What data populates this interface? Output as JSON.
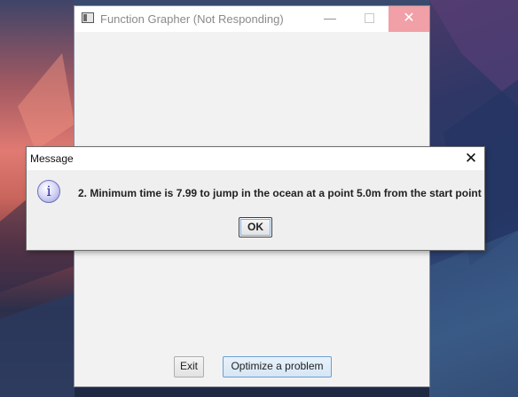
{
  "main_window": {
    "title": "Function Grapher (Not Responding)",
    "controls": {
      "minimize": "—",
      "close": "✕"
    },
    "buttons": {
      "exit": "Exit",
      "optimize": "Optimize a problem"
    }
  },
  "dialog": {
    "title": "Message",
    "icon": "info-icon",
    "icon_glyph": "i",
    "close": "✕",
    "message": "2. Minimum time is 7.99 to jump in the ocean at a point 5.0m from the start point",
    "ok_label": "OK"
  },
  "colors": {
    "close_hover": "#f0a0a6",
    "dialog_bg": "#efefef",
    "window_bg": "#f2f2f2"
  }
}
